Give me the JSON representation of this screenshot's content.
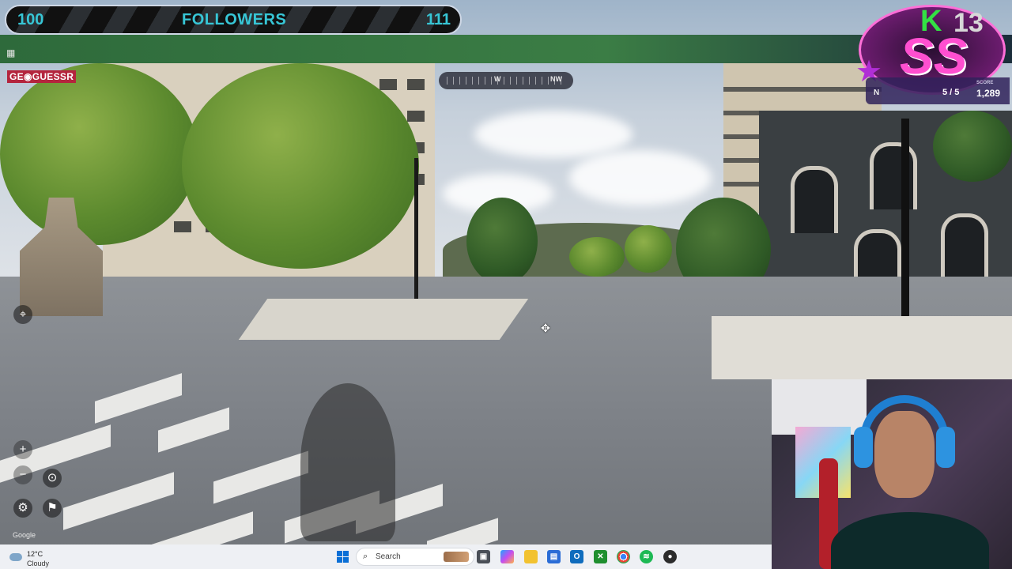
{
  "followers_goal": {
    "start": "100",
    "title": "FOLLOWERS",
    "end": "111"
  },
  "logo": {
    "letter": "K",
    "number": "13",
    "mark": "SS"
  },
  "game": {
    "brand": "GE◉GUESSR",
    "compass": {
      "left": "W",
      "right": "NW"
    },
    "round_label": "N",
    "round_value": "5 / 5",
    "score_label": "SCORE",
    "score_value": "1,289"
  },
  "map_controls": {
    "google_label": "Google"
  },
  "taskbar": {
    "weather_temp": "12°C",
    "weather_condition": "Cloudy",
    "search_label": "Search",
    "apps": [
      "task-view",
      "copilot",
      "file-explorer",
      "store",
      "outlook",
      "xbox",
      "chrome",
      "spotify",
      "obs"
    ]
  },
  "colors": {
    "followers_text": "#37c6d6",
    "followers_end": "#6ad18a",
    "brand_red": "#b4253d",
    "score_panel": "#30225a",
    "logo_pink": "#ff4fd0",
    "logo_green": "#33e044"
  }
}
